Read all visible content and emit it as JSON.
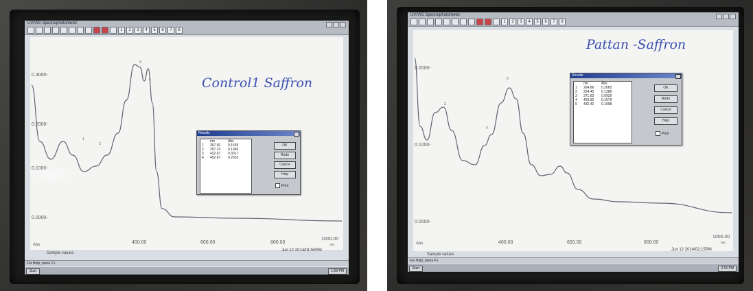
{
  "left": {
    "title_bar": "UV/VIS Spectrophotometer",
    "toolbar_numbers": [
      "1",
      "2",
      "3",
      "4",
      "5",
      "6",
      "7",
      "8"
    ],
    "handwritten_note": "Control1 Saffron",
    "dialog": {
      "title": "Results",
      "col_headers": [
        "",
        "nm",
        "Abs"
      ],
      "rows": [
        [
          "1",
          "267.50",
          "0.1539"
        ],
        [
          "2",
          "257.23",
          "0.1366"
        ],
        [
          "3",
          "432.67",
          "0.3017"
        ],
        [
          "4",
          "452.87",
          "0.2633"
        ]
      ],
      "ok": "OK",
      "redo": "Redo",
      "cancel": "Cancel",
      "help": "Help",
      "print": "Print"
    },
    "y_ticks": [
      "0.3000-",
      "0.2000-",
      "0.1000-",
      "0.0000-"
    ],
    "x_ticks": [
      "400.00",
      "600.00",
      "800.00",
      "1000.00"
    ],
    "x_unit": "nm",
    "y_unit": "Abs",
    "sample_label": "Sample values",
    "timestamp": "Jun 12 2014/01:59PM",
    "status": "For Help, press F1",
    "start": "Start",
    "clock": "1:59 PM",
    "peak_labels": [
      "1",
      "2",
      "3",
      "4"
    ]
  },
  "right": {
    "title_bar": "UV/VIS Spectrophotometer",
    "toolbar_numbers": [
      "1",
      "2",
      "3",
      "4",
      "5",
      "6",
      "7",
      "8"
    ],
    "handwritten_note": "Pattan -Saffron",
    "dialog": {
      "title": "Results",
      "col_headers": [
        "",
        "nm",
        "Abs"
      ],
      "rows": [
        [
          "1",
          "264.86",
          "0.2065"
        ],
        [
          "2",
          "254.45",
          "0.1288"
        ],
        [
          "3",
          "371.83",
          "0.0929"
        ],
        [
          "4",
          "423.92",
          "0.1579"
        ],
        [
          "5",
          "432.42",
          "0.1598"
        ]
      ],
      "ok": "OK",
      "redo": "Redo",
      "cancel": "Cancel",
      "help": "Help",
      "print": "Print"
    },
    "y_ticks": [
      "0.2000-",
      "0.1000-",
      "0.0000-"
    ],
    "x_ticks": [
      "400.00",
      "600.00",
      "800.00",
      "1000.00"
    ],
    "x_unit": "nm",
    "y_unit": "Abs",
    "sample_label": "Sample values",
    "timestamp": "Jun 12 2014/02:15PM",
    "status": "For Help, press F1",
    "start": "Start",
    "clock": "2:15 PM",
    "peak_labels": [
      "2",
      "4",
      "5"
    ]
  },
  "colors": {
    "spectrum_line": "#5d6270",
    "handwriting": "#3a4fb0",
    "dialog_title": "#1f3d8f"
  }
}
